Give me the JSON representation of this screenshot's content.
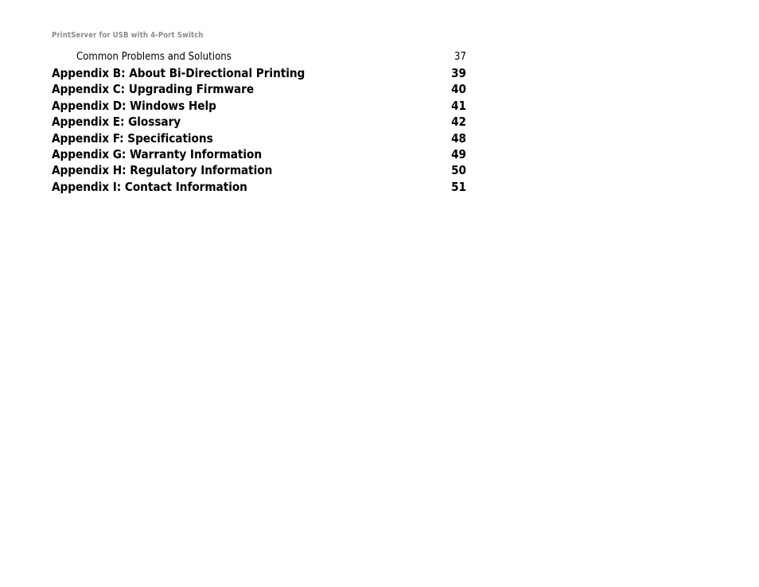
{
  "document": {
    "running_header": "PrintServer for USB with 4-Port Switch",
    "background_color": "#ffffff",
    "text_color": "#000000",
    "header_color": "#8c8c8c"
  },
  "toc": {
    "entries": [
      {
        "title": "Common Problems and Solutions",
        "page": "37",
        "level": 2
      },
      {
        "title": "Appendix B: About Bi-Directional Printing",
        "page": "39",
        "level": 1
      },
      {
        "title": "Appendix C: Upgrading Firmware",
        "page": "40",
        "level": 1
      },
      {
        "title": "Appendix D: Windows Help",
        "page": "41",
        "level": 1
      },
      {
        "title": "Appendix E: Glossary",
        "page": "42",
        "level": 1
      },
      {
        "title": "Appendix F: Specifications",
        "page": "48",
        "level": 1
      },
      {
        "title": "Appendix G: Warranty Information",
        "page": "49",
        "level": 1
      },
      {
        "title": "Appendix H: Regulatory Information",
        "page": "50",
        "level": 1
      },
      {
        "title": "Appendix I: Contact Information",
        "page": "51",
        "level": 1
      }
    ]
  }
}
